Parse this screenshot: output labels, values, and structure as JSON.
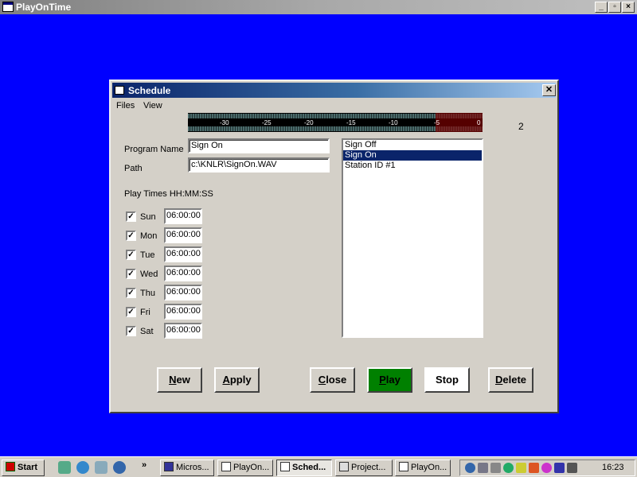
{
  "app": {
    "title": "PlayOnTime"
  },
  "dialog": {
    "title": "Schedule",
    "close_glyph": "✕",
    "menu": [
      "Files",
      "View"
    ],
    "meter": {
      "ticks": [
        "-30",
        "-25",
        "-20",
        "-15",
        "-10",
        "-5",
        "0"
      ],
      "count": "2"
    },
    "program_name_label": "Program Name",
    "program_name_value": "Sign On",
    "path_label": "Path",
    "path_value": "c:\\KNLR\\SignOn.WAV",
    "play_times_label": "Play Times HH:MM:SS",
    "days": [
      {
        "day": "Sun",
        "time": "06:00:00",
        "checked": true
      },
      {
        "day": "Mon",
        "time": "06:00:00",
        "checked": true
      },
      {
        "day": "Tue",
        "time": "06:00:00",
        "checked": true
      },
      {
        "day": "Wed",
        "time": "06:00:00",
        "checked": true
      },
      {
        "day": "Thu",
        "time": "06:00:00",
        "checked": true
      },
      {
        "day": "Fri",
        "time": "06:00:00",
        "checked": true
      },
      {
        "day": "Sat",
        "time": "06:00:00",
        "checked": true
      }
    ],
    "list_items": [
      {
        "label": "Sign Off",
        "selected": false
      },
      {
        "label": "Sign On",
        "selected": true
      },
      {
        "label": "Station ID #1",
        "selected": false
      }
    ],
    "buttons": {
      "new": {
        "u": "N",
        "rest": "ew"
      },
      "apply": {
        "u": "A",
        "rest": "pply"
      },
      "close": {
        "u": "C",
        "rest": "lose"
      },
      "play": {
        "u": "P",
        "rest": "lay"
      },
      "stop": {
        "u": "",
        "rest": "Stop"
      },
      "delete": {
        "u": "D",
        "rest": "elete"
      }
    }
  },
  "taskbar": {
    "start_label": "Start",
    "chevron": "»",
    "tasks": [
      "Micros...",
      "PlayOn...",
      "Sched...",
      "Project...",
      "PlayOn..."
    ],
    "clock": "16:23"
  },
  "colors": {
    "desktop": "#0000ff",
    "play_button": "#008000",
    "selection": "#0a246a"
  }
}
